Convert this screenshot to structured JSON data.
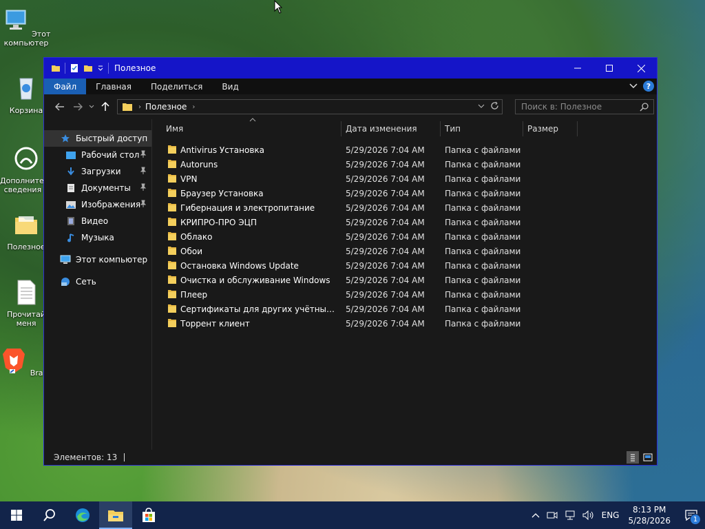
{
  "desktop": {
    "icons": [
      {
        "label": "Этот компьютер"
      },
      {
        "label": "Корзина"
      },
      {
        "label": "Дополнительные сведения о"
      },
      {
        "label": "Полезное"
      },
      {
        "label": "Прочитай меня"
      },
      {
        "label": "Brave"
      }
    ]
  },
  "window": {
    "title": "Полезное",
    "ribbon_tabs": [
      "Файл",
      "Главная",
      "Поделиться",
      "Вид"
    ],
    "address_crumb": "Полезное",
    "search_placeholder": "Поиск в: Полезное",
    "nav": {
      "quick_access": "Быстрый доступ",
      "pinned": [
        "Рабочий стол",
        "Загрузки",
        "Документы",
        "Изображения"
      ],
      "unpinned": [
        "Видео",
        "Музыка"
      ],
      "this_pc": "Этот компьютер",
      "network": "Сеть"
    },
    "columns": {
      "name": "Имя",
      "date": "Дата изменения",
      "type": "Тип",
      "size": "Размер"
    },
    "files": [
      {
        "name": "Antivirus Установка",
        "date": "5/29/2026 7:04 AM",
        "type": "Папка с файлами"
      },
      {
        "name": "Autoruns",
        "date": "5/29/2026 7:04 AM",
        "type": "Папка с файлами"
      },
      {
        "name": "VPN",
        "date": "5/29/2026 7:04 AM",
        "type": "Папка с файлами"
      },
      {
        "name": "Браузер Установка",
        "date": "5/29/2026 7:04 AM",
        "type": "Папка с файлами"
      },
      {
        "name": "Гибернация и электропитание",
        "date": "5/29/2026 7:04 AM",
        "type": "Папка с файлами"
      },
      {
        "name": "КРИПРО-ПРО ЭЦП",
        "date": "5/29/2026 7:04 AM",
        "type": "Папка с файлами"
      },
      {
        "name": "Облако",
        "date": "5/29/2026 7:04 AM",
        "type": "Папка с файлами"
      },
      {
        "name": "Обои",
        "date": "5/29/2026 7:04 AM",
        "type": "Папка с файлами"
      },
      {
        "name": "Остановка Windows Update",
        "date": "5/29/2026 7:04 AM",
        "type": "Папка с файлами"
      },
      {
        "name": "Очистка и обслуживание Windows",
        "date": "5/29/2026 7:04 AM",
        "type": "Папка с файлами"
      },
      {
        "name": "Плеер",
        "date": "5/29/2026 7:04 AM",
        "type": "Папка с файлами"
      },
      {
        "name": "Сертификаты для других учётных запи...",
        "date": "5/29/2026 7:04 AM",
        "type": "Папка с файлами"
      },
      {
        "name": "Торрент клиент",
        "date": "5/29/2026 7:04 AM",
        "type": "Папка с файлами"
      }
    ],
    "status_text": "Элементов: 13"
  },
  "taskbar": {
    "language": "ENG",
    "time": "8:13 PM",
    "date": "5/28/2026",
    "notification_count": "1"
  },
  "colors": {
    "titlebar": "#1515c8",
    "accent": "#1a5fb4",
    "folder": "#f4cf5c",
    "taskbar": "#12244a"
  }
}
